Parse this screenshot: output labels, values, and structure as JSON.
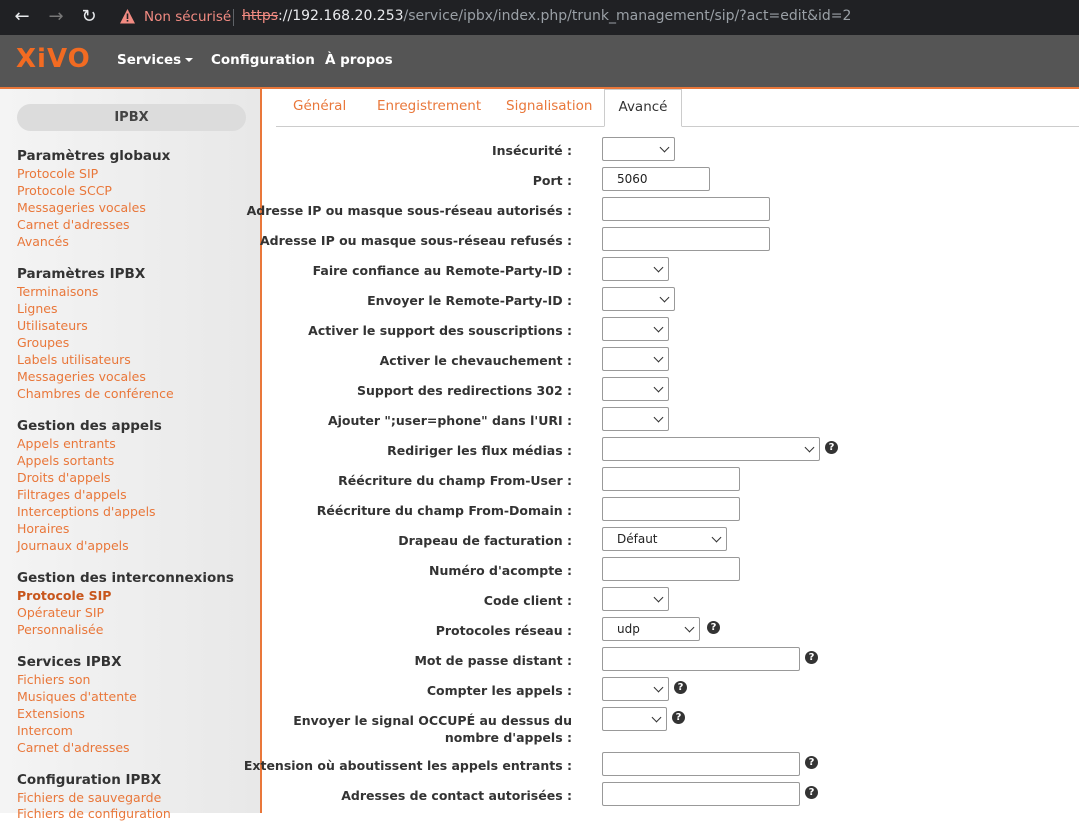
{
  "browser": {
    "not_secure": "Non sécurisé",
    "url_scheme": "https",
    "url_host": "://192.168.20.253",
    "url_path": "/service/ipbx/index.php/trunk_management/sip/?act=edit&id=2"
  },
  "header": {
    "logo": "XiVO",
    "nav": {
      "services": "Services",
      "configuration": "Configuration",
      "apropos": "À propos"
    }
  },
  "sidebar": {
    "pill": "IPBX",
    "sections": [
      {
        "title": "Paramètres globaux",
        "items": [
          "Protocole SIP",
          "Protocole SCCP",
          "Messageries vocales",
          "Carnet d'adresses",
          "Avancés"
        ]
      },
      {
        "title": "Paramètres IPBX",
        "items": [
          "Terminaisons",
          "Lignes",
          "Utilisateurs",
          "Groupes",
          "Labels utilisateurs",
          "Messageries vocales",
          "Chambres de conférence"
        ]
      },
      {
        "title": "Gestion des appels",
        "items": [
          "Appels entrants",
          "Appels sortants",
          "Droits d'appels",
          "Filtrages d'appels",
          "Interceptions d'appels",
          "Horaires",
          "Journaux d'appels"
        ]
      },
      {
        "title": "Gestion des interconnexions",
        "items": [
          "Protocole SIP",
          "Opérateur SIP",
          "Personnalisée"
        ]
      },
      {
        "title": "Services IPBX",
        "items": [
          "Fichiers son",
          "Musiques d'attente",
          "Extensions",
          "Intercom",
          "Carnet d'adresses"
        ]
      },
      {
        "title": "Configuration IPBX",
        "items": [
          "Fichiers de sauvegarde",
          "Fichiers de configuration"
        ]
      }
    ]
  },
  "tabs": [
    "Général",
    "Enregistrement",
    "Signalisation",
    "Avancé"
  ],
  "form": {
    "insecure": {
      "label": "Insécurité :",
      "value": ""
    },
    "port": {
      "label": "Port :",
      "value": "5060"
    },
    "permit": {
      "label": "Adresse IP ou masque sous-réseau autorisés :",
      "value": ""
    },
    "deny": {
      "label": "Adresse IP ou masque sous-réseau refusés :",
      "value": ""
    },
    "trustrpid": {
      "label": "Faire confiance au Remote-Party-ID :",
      "value": ""
    },
    "sendrpid": {
      "label": "Envoyer le Remote-Party-ID :",
      "value": ""
    },
    "subscribe": {
      "label": "Activer le support des souscriptions :",
      "value": ""
    },
    "overlap": {
      "label": "Activer le chevauchement :",
      "value": ""
    },
    "redirect302": {
      "label": "Support des redirections 302 :",
      "value": ""
    },
    "userphone": {
      "label": "Ajouter \";user=phone\" dans l'URI :",
      "value": ""
    },
    "directmedia": {
      "label": "Rediriger les flux médias :",
      "value": ""
    },
    "fromuser": {
      "label": "Réécriture du champ From-User :",
      "value": ""
    },
    "fromdomain": {
      "label": "Réécriture du champ From-Domain :",
      "value": ""
    },
    "amaflags": {
      "label": "Drapeau de facturation :",
      "value": "Défaut"
    },
    "accountcode": {
      "label": "Numéro d'acompte :",
      "value": ""
    },
    "clientcode": {
      "label": "Code client :",
      "value": ""
    },
    "transport": {
      "label": "Protocoles réseau :",
      "value": "udp"
    },
    "remotesecret": {
      "label": "Mot de passe distant :",
      "value": ""
    },
    "callcounter": {
      "label": "Compter les appels :",
      "value": ""
    },
    "busylevel": {
      "label_line1": "Envoyer le signal OCCUPÉ au dessus du",
      "label_line2": "nombre d'appels :",
      "value": ""
    },
    "incomingext": {
      "label": "Extension où aboutissent les appels entrants :",
      "value": ""
    },
    "contactpermit": {
      "label": "Adresses de contact autorisées :",
      "value": ""
    }
  }
}
